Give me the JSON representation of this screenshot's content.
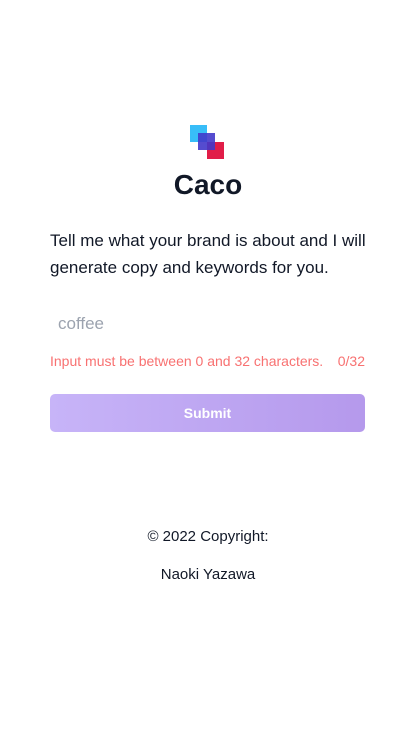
{
  "app": {
    "title": "Caco",
    "logo_icon": "stacked-squares-logo-icon",
    "logo_colors": [
      "#38bdf8",
      "#4338ca",
      "#e11d48"
    ]
  },
  "intro": {
    "text": "Tell me what your brand is about and I will generate copy and keywords for you."
  },
  "input": {
    "placeholder": "coffee",
    "value": ""
  },
  "validation": {
    "error_text": "Input must be between 0 and 32 characters.",
    "counter": "0/32",
    "error_color": "#f87171"
  },
  "submit": {
    "label": "Submit",
    "gradient": [
      "#c7b4f8",
      "#b599ec"
    ]
  },
  "footer": {
    "copyright": "© 2022 Copyright:",
    "author": "Naoki Yazawa"
  }
}
